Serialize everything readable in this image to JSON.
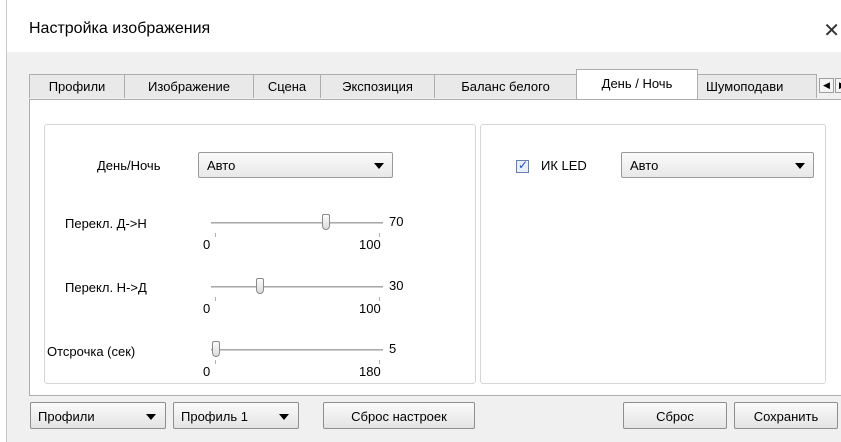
{
  "window": {
    "title": "Настройка изображения",
    "close_glyph": "✕"
  },
  "tabs": [
    {
      "label": "Профили",
      "active": false
    },
    {
      "label": "Изображение",
      "active": false
    },
    {
      "label": "Сцена",
      "active": false
    },
    {
      "label": "Экспозиция",
      "active": false
    },
    {
      "label": "Баланс белого",
      "active": false
    },
    {
      "label": "День / Ночь",
      "active": true
    },
    {
      "label": "Шумоподави",
      "active": false
    }
  ],
  "tab_scroll": {
    "left": "◀",
    "right": "▶"
  },
  "day_night": {
    "mode_label": "День/Ночь",
    "mode_value": "Авто",
    "sliders": [
      {
        "label": "Перекл. Д->Н",
        "min": "0",
        "max": "100",
        "value": "70",
        "fraction": 0.7
      },
      {
        "label": "Перекл. Н->Д",
        "min": "0",
        "max": "100",
        "value": "30",
        "fraction": 0.3
      },
      {
        "label": "Отсрочка (сек)",
        "min": "0",
        "max": "180",
        "value": "5",
        "fraction": 0.028
      }
    ]
  },
  "ir_led": {
    "checked": true,
    "label": "ИК LED",
    "mode_value": "Авто"
  },
  "bottom": {
    "profiles_select": "Профили",
    "profile_select": "Профиль 1",
    "reset_settings": "Сброс настроек",
    "reset": "Сброс",
    "save": "Сохранить"
  }
}
